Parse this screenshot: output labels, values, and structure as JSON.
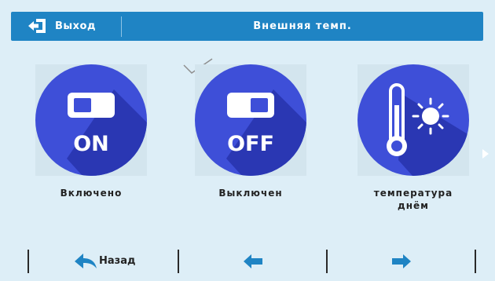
{
  "header": {
    "exit_label": "Выход",
    "title": "Внешняя темп."
  },
  "tiles": [
    {
      "icon_text": "ON",
      "label": "Включено"
    },
    {
      "icon_text": "OFF",
      "label": "Выключен"
    },
    {
      "label_line1": "температура",
      "label_line2": "днём"
    }
  ],
  "footer": {
    "back_label": "Назад"
  },
  "colors": {
    "header_bg": "#1f84c4",
    "page_bg": "#ddeef7",
    "icon_circle": "#3e4fd8",
    "icon_shadow": "#2a37b3",
    "nav_arrow": "#1f84c4"
  }
}
